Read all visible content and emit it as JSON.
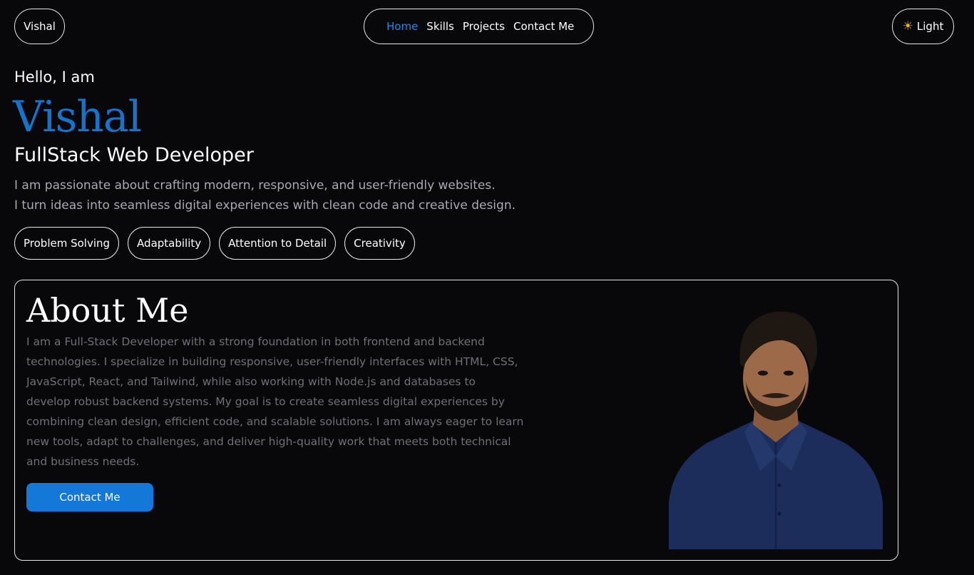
{
  "header": {
    "brand": "Vishal",
    "nav": [
      {
        "label": "Home",
        "active": true
      },
      {
        "label": "Skills",
        "active": false
      },
      {
        "label": "Projects",
        "active": false
      },
      {
        "label": "Contact Me",
        "active": false
      }
    ],
    "theme_toggle": {
      "icon": "sun-icon",
      "label": "Light"
    }
  },
  "hero": {
    "greeting": "Hello, I am",
    "name": "Vishal",
    "role": "FullStack Web Developer",
    "tagline": [
      "I am passionate about crafting modern, responsive, and user-friendly websites.",
      "I turn ideas into seamless digital experiences with clean code and creative design."
    ],
    "skills": [
      "Problem Solving",
      "Adaptability",
      "Attention to Detail",
      "Creativity"
    ]
  },
  "about": {
    "title": "About Me",
    "lines": [
      "I am a Full-Stack Developer with a strong foundation in both frontend and backend",
      "technologies. I specialize in building responsive, user-friendly interfaces with HTML, CSS,",
      "JavaScript, React, and Tailwind, while also working with Node.js and databases to",
      "develop robust backend systems. My goal is to create seamless digital experiences by",
      "combining clean design, efficient code, and scalable solutions. I am always eager to learn",
      "new tools, adapt to challenges, and deliver high-quality work that meets both technical",
      "and business needs."
    ],
    "button_label": "Contact Me"
  },
  "colors": {
    "background": "#08080a",
    "accent": "#1e88e5",
    "button": "#1478d9",
    "muted_text": "#6f6f75"
  }
}
